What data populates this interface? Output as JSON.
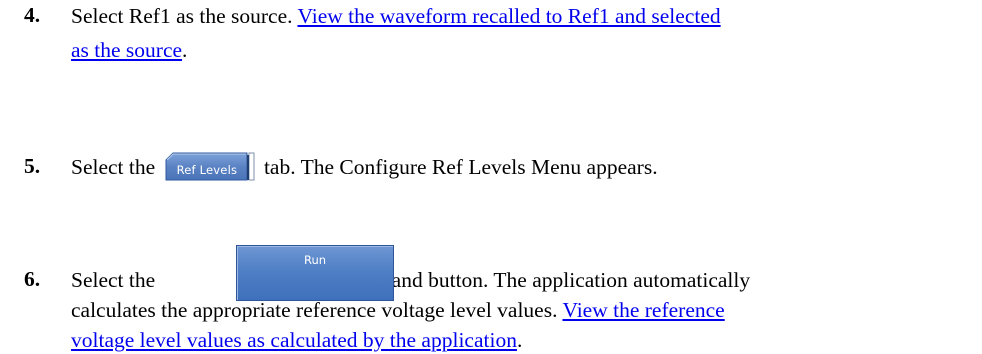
{
  "steps": [
    {
      "number": "4.",
      "text_before_link": "Select Ref1 as the source. ",
      "link_line1": "View the waveform recalled to Ref1 and selected",
      "link_line2": "as the source",
      "text_after_link": "."
    },
    {
      "number": "5.",
      "text_before_image": "Select the ",
      "tab_label": "Ref Levels",
      "text_after_image": " tab. The Configure Ref Levels Menu appears."
    },
    {
      "number": "6.",
      "text_before_image": "Select the ",
      "button_label": "Run",
      "text_after_image": " command button. The application automatically",
      "line2": "calculates the appropriate reference voltage level values. ",
      "link_line2": "View the reference",
      "link_line3": "voltage level values as calculated by the application",
      "text_after_link": "."
    }
  ],
  "colors": {
    "link": "#0000ee",
    "tab_background": "#5b83c4",
    "button_background": "#4f7fc5"
  }
}
